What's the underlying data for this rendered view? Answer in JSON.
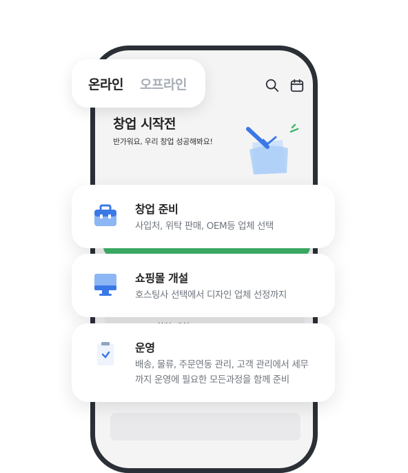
{
  "toggle": {
    "online": "온라인",
    "offline": "오프라인"
  },
  "phone": {
    "hero_title": "창업 시작전",
    "hero_subtitle": "반가워요, 우리 창업 성공해봐요!",
    "faded_row_label": "창업 계획"
  },
  "icons": {
    "search": "search-icon",
    "calendar": "calendar-icon"
  },
  "cards": [
    {
      "title": "창업 준비",
      "desc": "사입처, 위탁 판매, OEM등 업체 선택",
      "icon": "briefcase-icon"
    },
    {
      "title": "쇼핑몰 개설",
      "desc": "호스팅사 선택에서 디자인 업체 선정까지",
      "icon": "monitor-icon"
    },
    {
      "title": "운영",
      "desc_line1": "배송, 물류, 주문연동 관리, 고객 관리에서 세무",
      "desc_line2": "까지 운영에 필요한 모든과정을 함께 준비",
      "icon": "clipboard-icon"
    }
  ],
  "colors": {
    "accent_blue": "#3b78e7",
    "green": "#3fb66b",
    "frame": "#2b2f36"
  }
}
